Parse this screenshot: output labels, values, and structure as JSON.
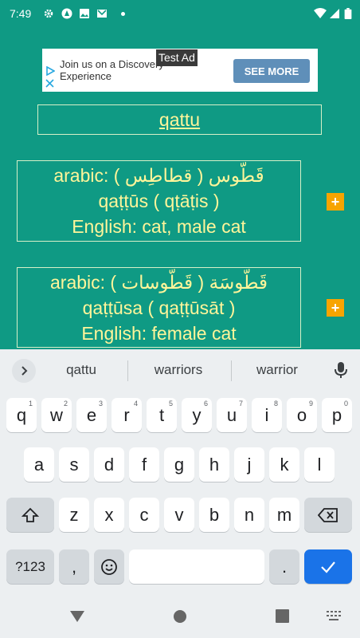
{
  "status_bar": {
    "time": "7:49"
  },
  "ad": {
    "text": "Join us on a Discovery Experience",
    "button": "SEE MORE",
    "badge": "Test Ad"
  },
  "search": {
    "word": "qattu"
  },
  "results": [
    {
      "arabic": "arabic: ( قطاطِس ) قَطّوس",
      "translit": "qaṭṭūs ( qṭāṭis )",
      "english": "English: cat, male cat",
      "add": "+"
    },
    {
      "arabic": "arabic: ( قَطّوسات ) قَطّوسَة",
      "translit": "qaṭṭūsa ( qaṭṭūsāt )",
      "english": "English: female cat",
      "add": "+"
    }
  ],
  "keyboard": {
    "suggestions": [
      "qattu",
      "warriors",
      "warrior"
    ],
    "row1": [
      "q",
      "w",
      "e",
      "r",
      "t",
      "y",
      "u",
      "i",
      "o",
      "p"
    ],
    "row1_hints": [
      "1",
      "2",
      "3",
      "4",
      "5",
      "6",
      "7",
      "8",
      "9",
      "0"
    ],
    "row2": [
      "a",
      "s",
      "d",
      "f",
      "g",
      "h",
      "j",
      "k",
      "l"
    ],
    "row3": [
      "z",
      "x",
      "c",
      "v",
      "b",
      "n",
      "m"
    ],
    "symbols_label": "?123",
    "comma": ",",
    "period": "."
  },
  "colors": {
    "background": "#0f9a84",
    "text_accent": "#fff59a",
    "plus_button": "#f7a400",
    "enter_key": "#1a73e8"
  }
}
